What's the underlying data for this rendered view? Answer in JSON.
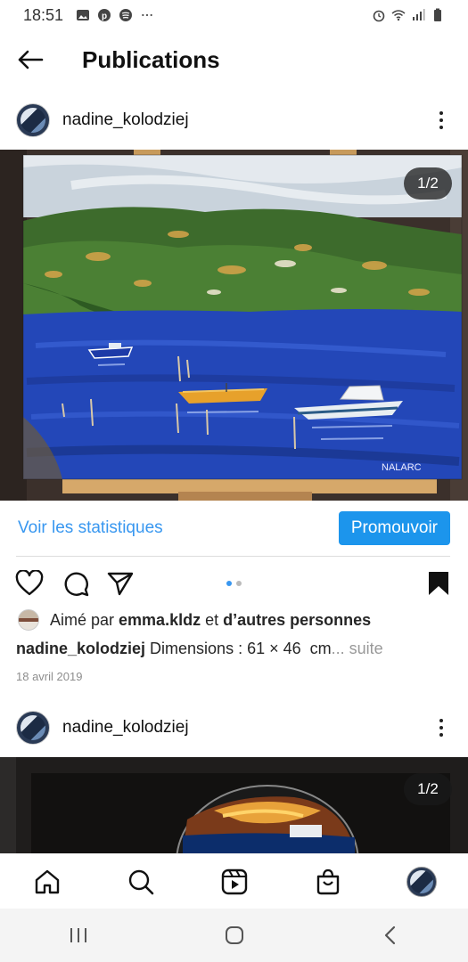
{
  "status_bar": {
    "time": "18:51",
    "notification_icons": [
      "image-icon",
      "pinterest-icon",
      "spotify-icon",
      "more-dots"
    ],
    "right_icons": [
      "alarm-icon",
      "wifi-icon",
      "signal-icon",
      "battery-icon"
    ]
  },
  "header": {
    "title": "Publications"
  },
  "post1": {
    "username": "nadine_kolodziej",
    "counter": "1/2",
    "stats_link": "Voir les statistiques",
    "promote_button": "Promouvoir",
    "carousel_index": 1,
    "carousel_total": 2,
    "likes_prefix": "Aimé par ",
    "likes_user": "emma.kldz",
    "likes_suffix": " et ",
    "likes_others": "d’autres personnes",
    "caption_user": "nadine_kolodziej",
    "caption_text": " Dimensions : 61 × 46  cm",
    "caption_more": "... suite",
    "date": "18 avril 2019",
    "signature": "NALARC"
  },
  "post2": {
    "username": "nadine_kolodziej",
    "counter": "1/2"
  },
  "bottom_nav": [
    "home-icon",
    "search-icon",
    "reels-icon",
    "shop-icon",
    "profile-avatar"
  ],
  "system_nav": [
    "recents-button",
    "home-button",
    "back-button"
  ],
  "colors": {
    "accent": "#3897f0",
    "promote": "#1c95ec",
    "text": "#262626",
    "muted": "#8e8e8e"
  }
}
